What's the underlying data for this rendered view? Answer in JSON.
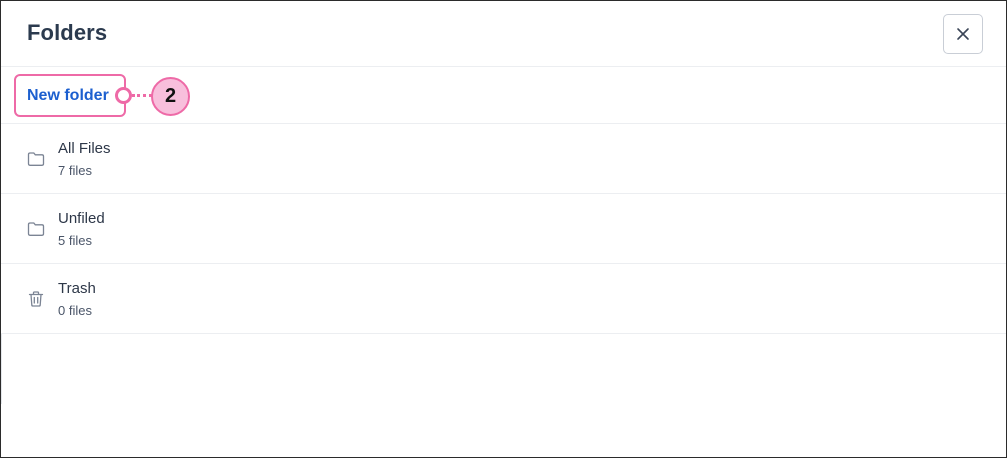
{
  "header": {
    "title": "Folders"
  },
  "toolbar": {
    "new_folder_label": "New folder",
    "callout_number": "2"
  },
  "folders": [
    {
      "name": "All Files",
      "count": "7 files",
      "icon": "folder-icon"
    },
    {
      "name": "Unfiled",
      "count": "5 files",
      "icon": "folder-icon"
    },
    {
      "name": "Trash",
      "count": "0 files",
      "icon": "trash-icon"
    }
  ],
  "colors": {
    "accent_link": "#1c5fcf",
    "callout_pink": "#ee6aa7",
    "callout_fill": "#f8bfdc",
    "title_text": "#2b3a4e"
  }
}
